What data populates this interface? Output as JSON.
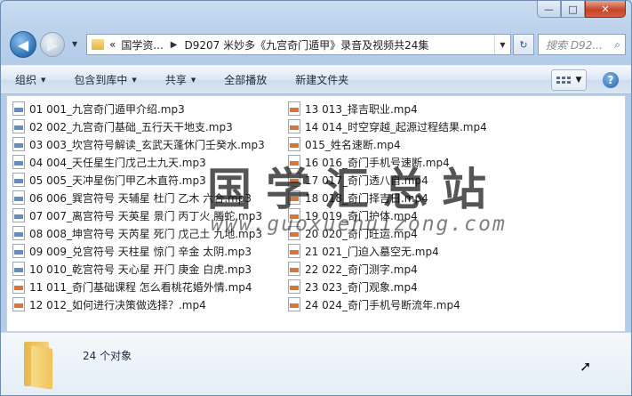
{
  "window": {
    "caption": {
      "minimize": "—",
      "maximize": "□",
      "close": "✕"
    }
  },
  "nav": {
    "back_icon": "back-arrow-icon",
    "forward_icon": "forward-arrow-icon",
    "address_prefix": "«",
    "address_parent": "国学资...",
    "address_current": "D9207 米妙多《九宫奇门遁甲》录音及视频共24集",
    "search_placeholder": "搜索 D92..."
  },
  "toolbar": {
    "organize": "组织",
    "include_library": "包含到库中",
    "share": "共享",
    "play_all": "全部播放",
    "new_folder": "新建文件夹"
  },
  "files_left": [
    {
      "name": "01 001_九宫奇门遁甲介绍.mp3",
      "type": "mp3"
    },
    {
      "name": "02 002_九宫奇门基础_五行天干地支.mp3",
      "type": "mp3"
    },
    {
      "name": "03 003_坎宫符号解读_玄武天蓬休门壬癸水.mp3",
      "type": "mp3"
    },
    {
      "name": "04 004_天任星生门戊己土九天.mp3",
      "type": "mp3"
    },
    {
      "name": "05 005_天冲星伤门甲乙木直符.mp3",
      "type": "mp3"
    },
    {
      "name": "06 006_巽宫符号 天辅星 杜门 乙木 六合.mp3",
      "type": "mp3"
    },
    {
      "name": "07 007_离宫符号 天英星 景门 丙丁火 螣蛇.mp3",
      "type": "mp3"
    },
    {
      "name": "08 008_坤宫符号 天芮星 死门 戊己土 九地.mp3",
      "type": "mp3"
    },
    {
      "name": "09 009_兑宫符号 天柱星 惊门 辛金 太阴.mp3",
      "type": "mp3"
    },
    {
      "name": "10 010_乾宫符号 天心星 开门 庚金 白虎.mp3",
      "type": "mp3"
    },
    {
      "name": "11 011_奇门基础课程 怎么看桃花婚外情.mp4",
      "type": "mp4"
    },
    {
      "name": "12 012_如何进行决策做选择？.mp4",
      "type": "mp4"
    }
  ],
  "files_right": [
    {
      "name": "13 013_择吉职业.mp4",
      "type": "mp4"
    },
    {
      "name": "14 014_时空穿越_起源过程结果.mp4",
      "type": "mp4"
    },
    {
      "name": "015_姓名速断.mp4",
      "type": "mp4"
    },
    {
      "name": "16 016_奇门手机号速断.mp4",
      "type": "mp4"
    },
    {
      "name": "17 017_奇门透八自.mp4",
      "type": "mp4"
    },
    {
      "name": "18 018_奇门择吉日.mp4",
      "type": "mp4"
    },
    {
      "name": "19 019_奇门护体.mp4",
      "type": "mp4"
    },
    {
      "name": "20 020_奇门旺运.mp4",
      "type": "mp4"
    },
    {
      "name": "21 021_门迫入墓空无.mp4",
      "type": "mp4"
    },
    {
      "name": "22 022_奇门测字.mp4",
      "type": "mp4"
    },
    {
      "name": "23 023_奇门观象.mp4",
      "type": "mp4"
    },
    {
      "name": "24 024_奇门手机号断流年.mp4",
      "type": "mp4"
    }
  ],
  "watermark": {
    "title": "国学汇总站",
    "url": "www.guoxuehuizong.com"
  },
  "details": {
    "count": "24 个对象"
  },
  "colors": {
    "mp3_icon": "#5e8fc6",
    "mp4_icon": "#d7763a",
    "close_button": "#c7452b"
  }
}
